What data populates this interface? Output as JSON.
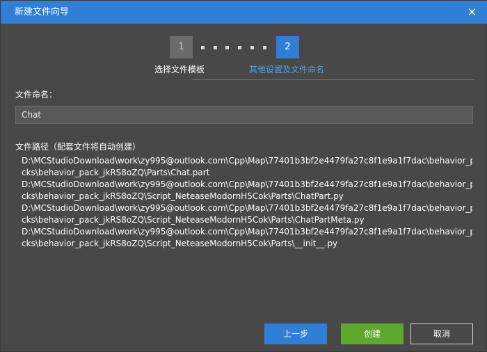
{
  "window": {
    "title": "新建文件向导",
    "close_glyph": "✕"
  },
  "stepper": {
    "steps": [
      {
        "number": "1",
        "label": "选择文件模板",
        "active": false
      },
      {
        "number": "2",
        "label": "其他设置及文件命名",
        "active": true
      }
    ]
  },
  "file_name": {
    "label": "文件命名：",
    "value": "Chat"
  },
  "file_path": {
    "label": "文件路径（配套文件将自动创建）",
    "lines": [
      "D:\\MCStudioDownload\\work\\zy995@outlook.com\\Cpp\\Map\\77401b3bf2e4479fa27c8f1e9a1f7dac\\behavior_pa",
      "cks\\behavior_pack_jkRS8oZQ\\Parts\\Chat.part",
      "D:\\MCStudioDownload\\work\\zy995@outlook.com\\Cpp\\Map\\77401b3bf2e4479fa27c8f1e9a1f7dac\\behavior_pa",
      "cks\\behavior_pack_jkRS8oZQ\\Script_NeteaseModornH5Cok\\Parts\\ChatPart.py",
      "D:\\MCStudioDownload\\work\\zy995@outlook.com\\Cpp\\Map\\77401b3bf2e4479fa27c8f1e9a1f7dac\\behavior_pa",
      "cks\\behavior_pack_jkRS8oZQ\\Script_NeteaseModornH5Cok\\Parts\\ChatPartMeta.py",
      "D:\\MCStudioDownload\\work\\zy995@outlook.com\\Cpp\\Map\\77401b3bf2e4479fa27c8f1e9a1f7dac\\behavior_pa",
      "cks\\behavior_pack_jkRS8oZQ\\Script_NeteaseModornH5Cok\\Parts\\__init__.py"
    ]
  },
  "buttons": {
    "prev": "上一步",
    "create": "创建",
    "cancel": "取消"
  },
  "colors": {
    "accent": "#2f7fd6",
    "create": "#5fa82e",
    "background": "#484848",
    "active_step_label": "#4aa3f0"
  }
}
